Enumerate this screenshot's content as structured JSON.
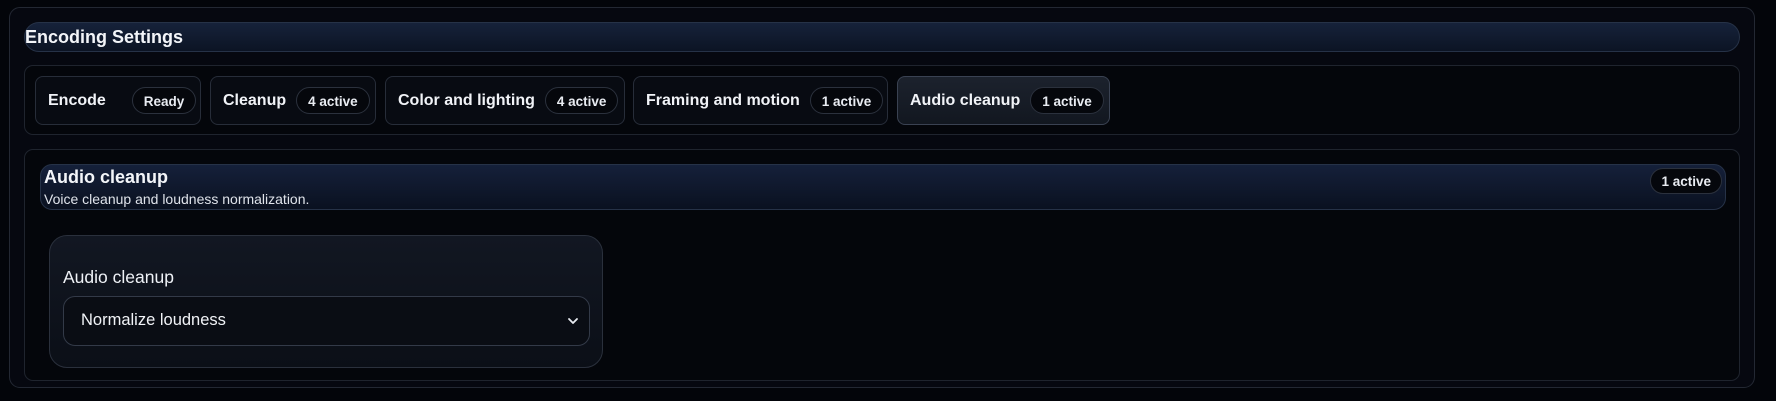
{
  "header": {
    "title": "Encoding Settings"
  },
  "tabs": [
    {
      "label": "Encode",
      "badge": "Ready",
      "active": false
    },
    {
      "label": "Cleanup",
      "badge": "4 active",
      "active": false
    },
    {
      "label": "Color and lighting",
      "badge": "4 active",
      "active": false
    },
    {
      "label": "Framing and motion",
      "badge": "1 active",
      "active": false
    },
    {
      "label": "Audio cleanup",
      "badge": "1 active",
      "active": true
    }
  ],
  "section": {
    "title": "Audio cleanup",
    "description": "Voice cleanup and loudness normalization.",
    "badge": "1 active"
  },
  "card": {
    "field_label": "Audio cleanup",
    "select_value": "Normalize loudness"
  },
  "icons": {
    "select_chevron": "chevron-down-icon"
  },
  "colors": {
    "background": "#03050a",
    "header_gradient": "#16223a",
    "active_tab": "#1c222d",
    "text": "#eef1f6"
  }
}
